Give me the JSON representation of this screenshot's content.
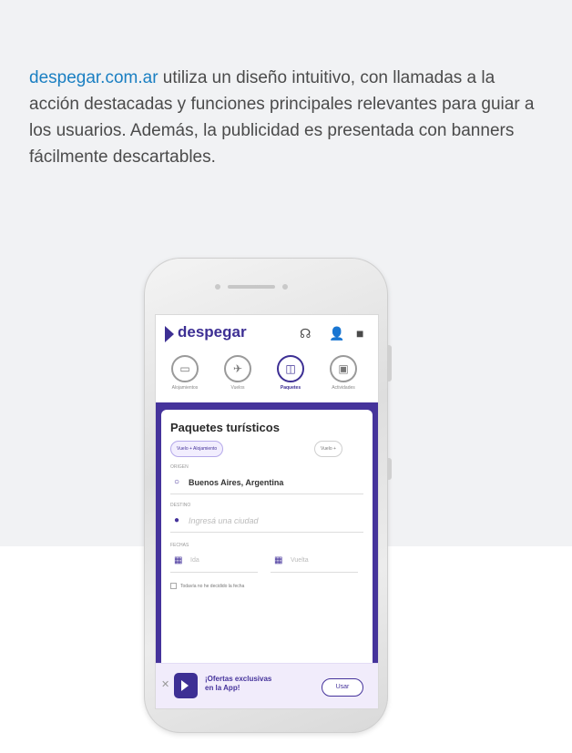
{
  "intro": {
    "link": "despegar.com.ar",
    "text": " utiliza un diseño intuitivo, con llamadas a la acción destacadas y funciones principales relevantes para guiar a los usuarios. Además, la publicidad es presentada con banners fácilmente descartables."
  },
  "app": {
    "brand": "despegar",
    "categories": [
      {
        "label": "Alojamientos",
        "icon": "bed-icon"
      },
      {
        "label": "Vuelos",
        "icon": "plane-icon"
      },
      {
        "label": "Paquetes",
        "icon": "suitcase-icon"
      },
      {
        "label": "Actividades",
        "icon": "ticket-icon"
      }
    ],
    "form": {
      "title": "Paquetes turísticos",
      "chips": [
        "Vuelo + Alojamiento",
        "Vuelo +"
      ],
      "origin_label": "ORIGEN",
      "origin_value": "Buenos Aires, Argentina",
      "destination_label": "DESTINO",
      "destination_placeholder": "Ingresá una ciudad",
      "dates_label": "FECHAS",
      "date_from": "Ida",
      "date_to": "Vuelta",
      "flex_check": "Todavía no he decidido la fecha"
    },
    "banner": {
      "message": "¡Ofertas exclusivas en la App!",
      "button": "Usar"
    }
  }
}
